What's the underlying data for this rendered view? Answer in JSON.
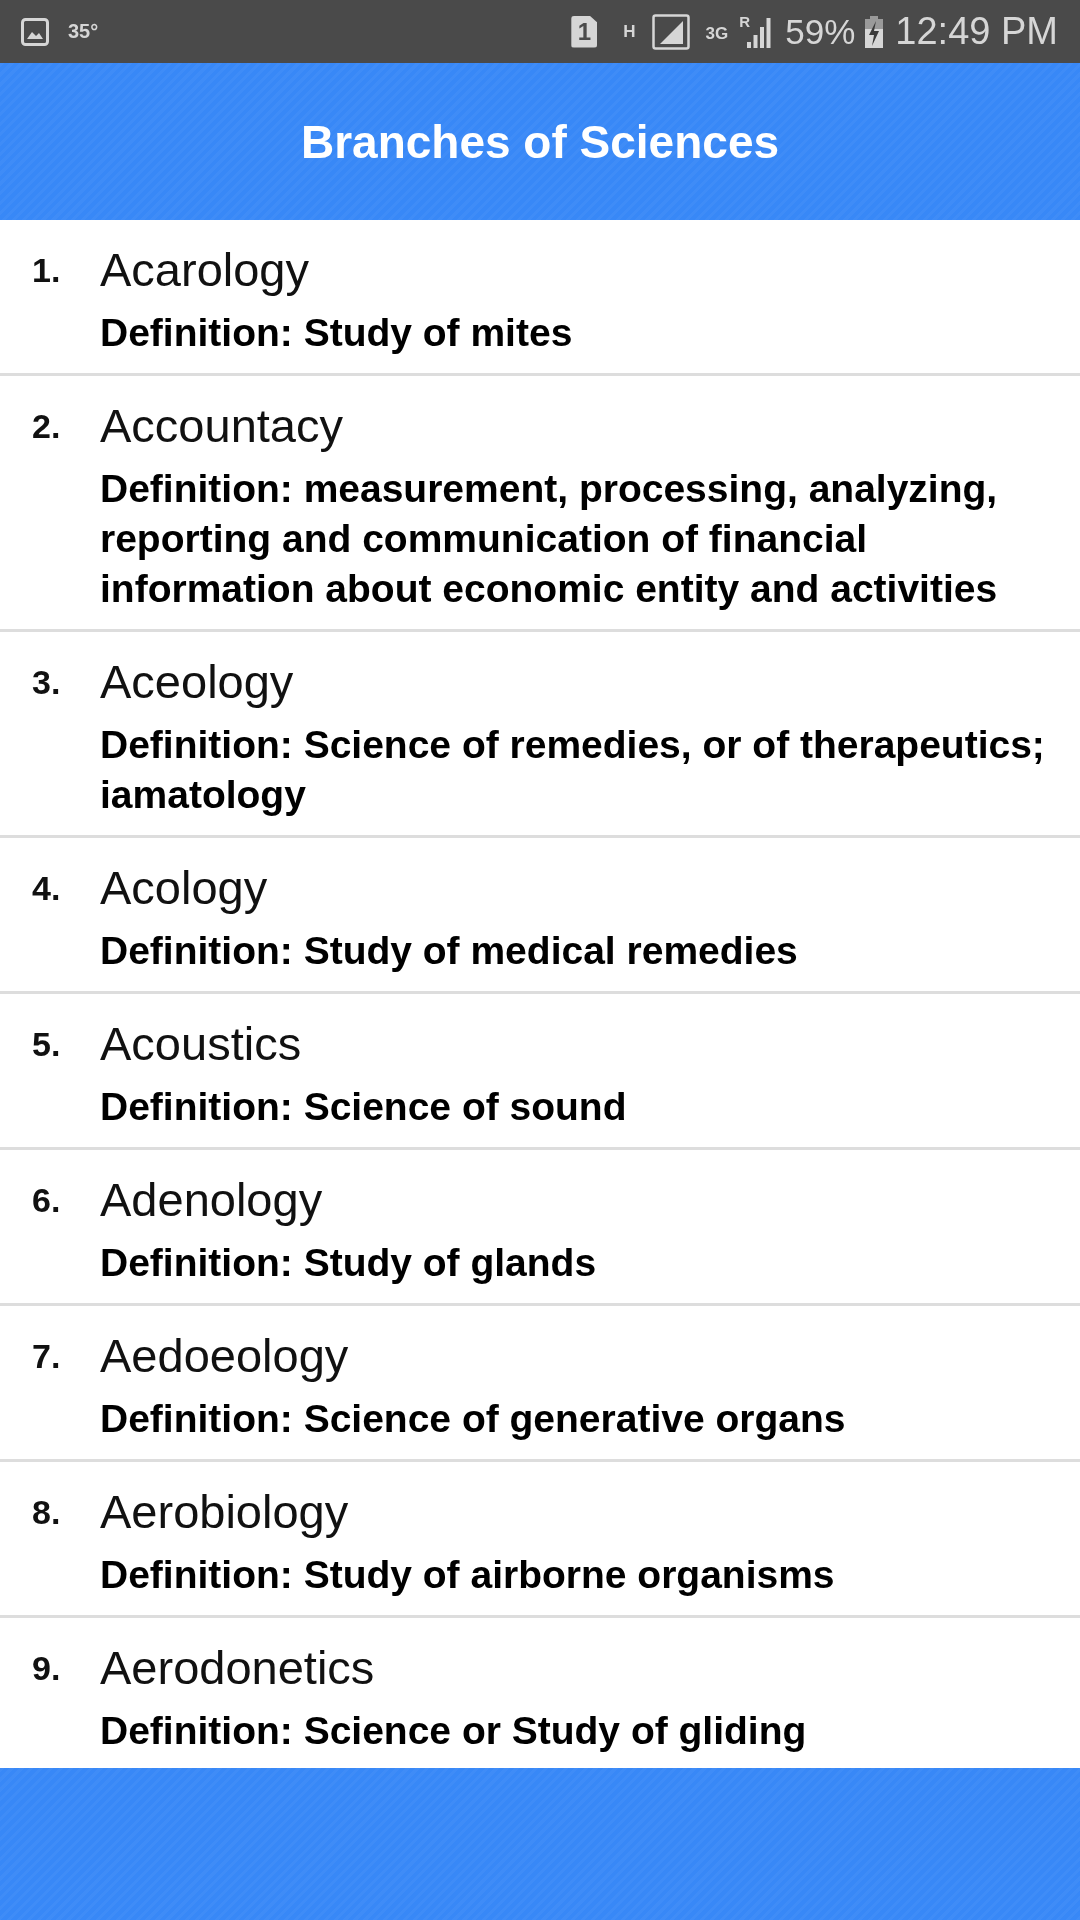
{
  "status_bar": {
    "temperature": "35°",
    "sim_slot": "1",
    "network_type": "H",
    "data_type": "3G",
    "roaming": "R",
    "battery_percent": "59%",
    "charging": true,
    "time": "12:49 PM"
  },
  "header": {
    "title": "Branches of Sciences"
  },
  "entries": [
    {
      "number": "1.",
      "name": "Acarology",
      "definition": "Definition: Study of mites"
    },
    {
      "number": "2.",
      "name": "Accountacy",
      "definition": "Definition: measurement, processing, analyzing, reporting and communication of financial information about economic entity and activities"
    },
    {
      "number": "3.",
      "name": "Aceology",
      "definition": "Definition: Science of remedies, or of therapeutics; iamatology"
    },
    {
      "number": "4.",
      "name": "Acology",
      "definition": "Definition: Study of medical remedies"
    },
    {
      "number": "5.",
      "name": "Acoustics",
      "definition": "Definition: Science of sound"
    },
    {
      "number": "6.",
      "name": "Adenology",
      "definition": "Definition: Study of glands"
    },
    {
      "number": "7.",
      "name": "Aedoeology",
      "definition": "Definition: Science of generative organs"
    },
    {
      "number": "8.",
      "name": "Aerobiology",
      "definition": "Definition: Study of airborne organisms"
    },
    {
      "number": "9.",
      "name": "Aerodonetics",
      "definition": "Definition: Science or Study of gliding"
    }
  ]
}
